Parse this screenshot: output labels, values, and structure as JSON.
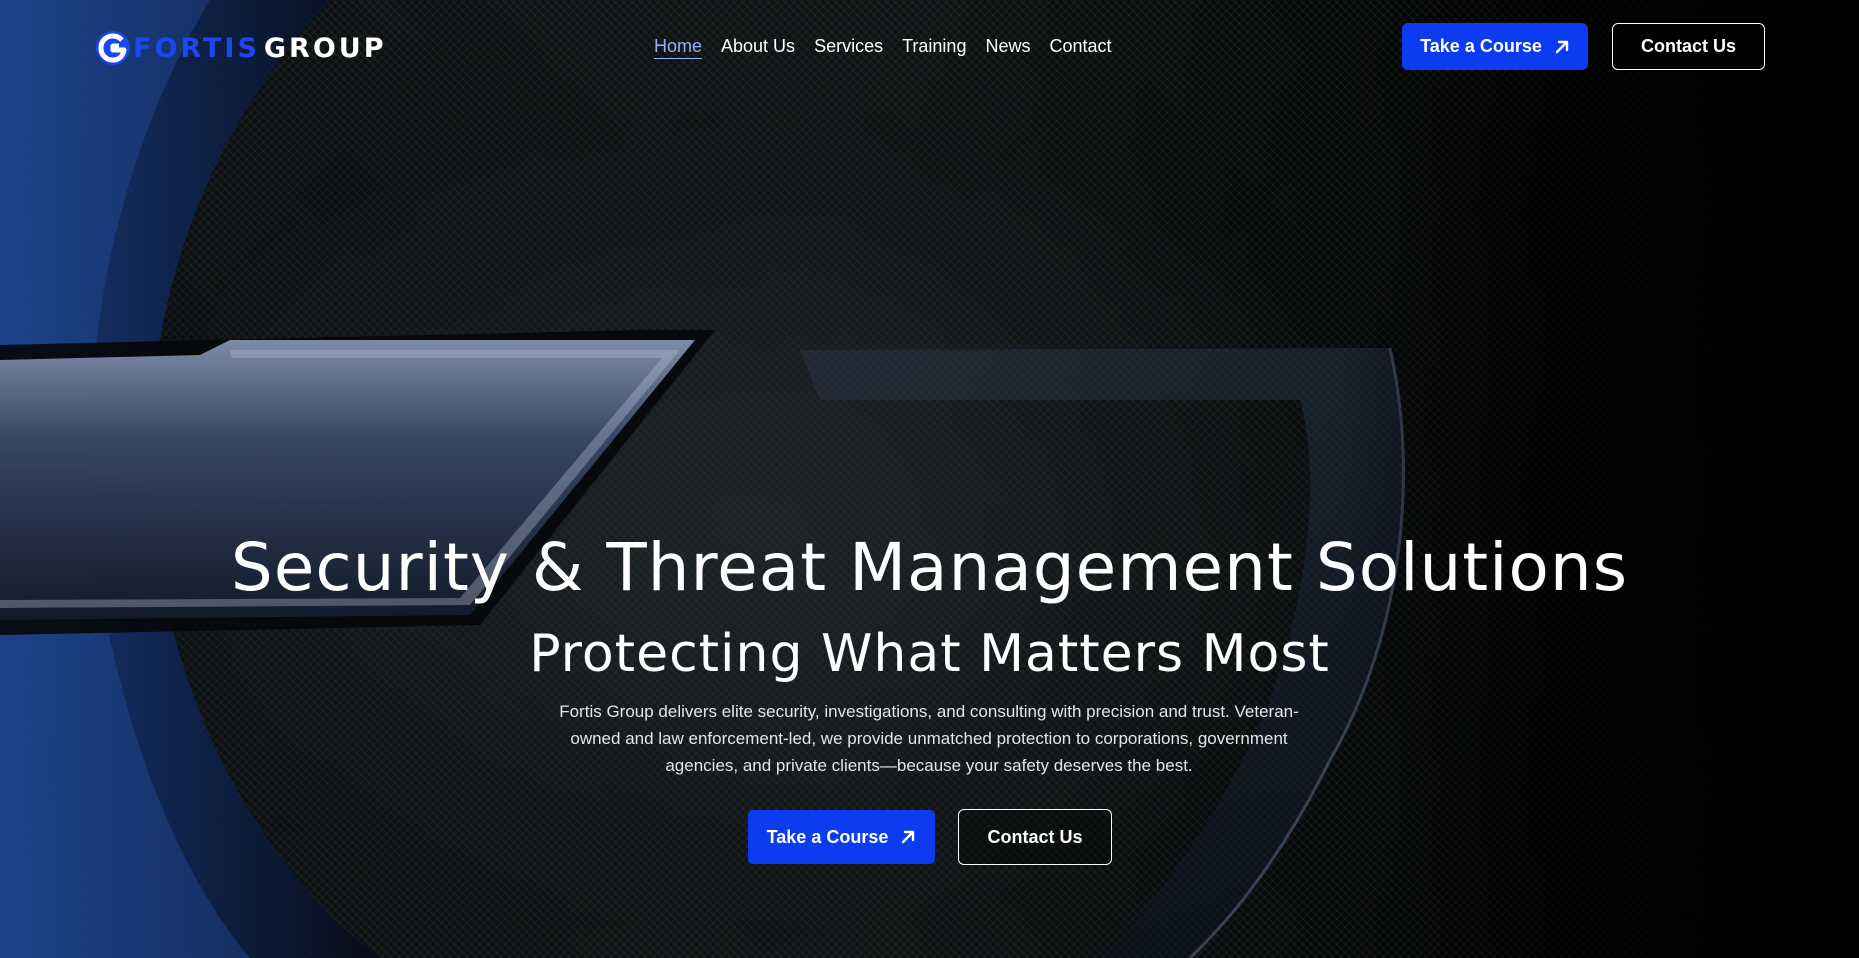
{
  "brand": {
    "name_part1": "FORTIS",
    "name_part2": "GROUP",
    "accent_color": "#0d3bf0"
  },
  "nav": {
    "items": [
      {
        "label": "Home",
        "active": true
      },
      {
        "label": "About Us",
        "active": false
      },
      {
        "label": "Services",
        "active": false
      },
      {
        "label": "Training",
        "active": false
      },
      {
        "label": "News",
        "active": false
      },
      {
        "label": "Contact",
        "active": false
      }
    ]
  },
  "header_actions": {
    "course_label": "Take a Course",
    "course_icon": "arrow-up-right-icon",
    "contact_label": "Contact Us"
  },
  "hero": {
    "headline": "Security & Threat Management Solutions",
    "subheadline": "Protecting What Matters Most",
    "description": "Fortis Group delivers elite security, investigations, and consulting with precision and trust. Veteran-owned and law enforcement-led, we provide unmatched protection to corporations, government agencies, and private clients—because your safety deserves the best.",
    "course_label": "Take a Course",
    "course_icon": "arrow-up-right-icon",
    "contact_label": "Contact Us"
  }
}
